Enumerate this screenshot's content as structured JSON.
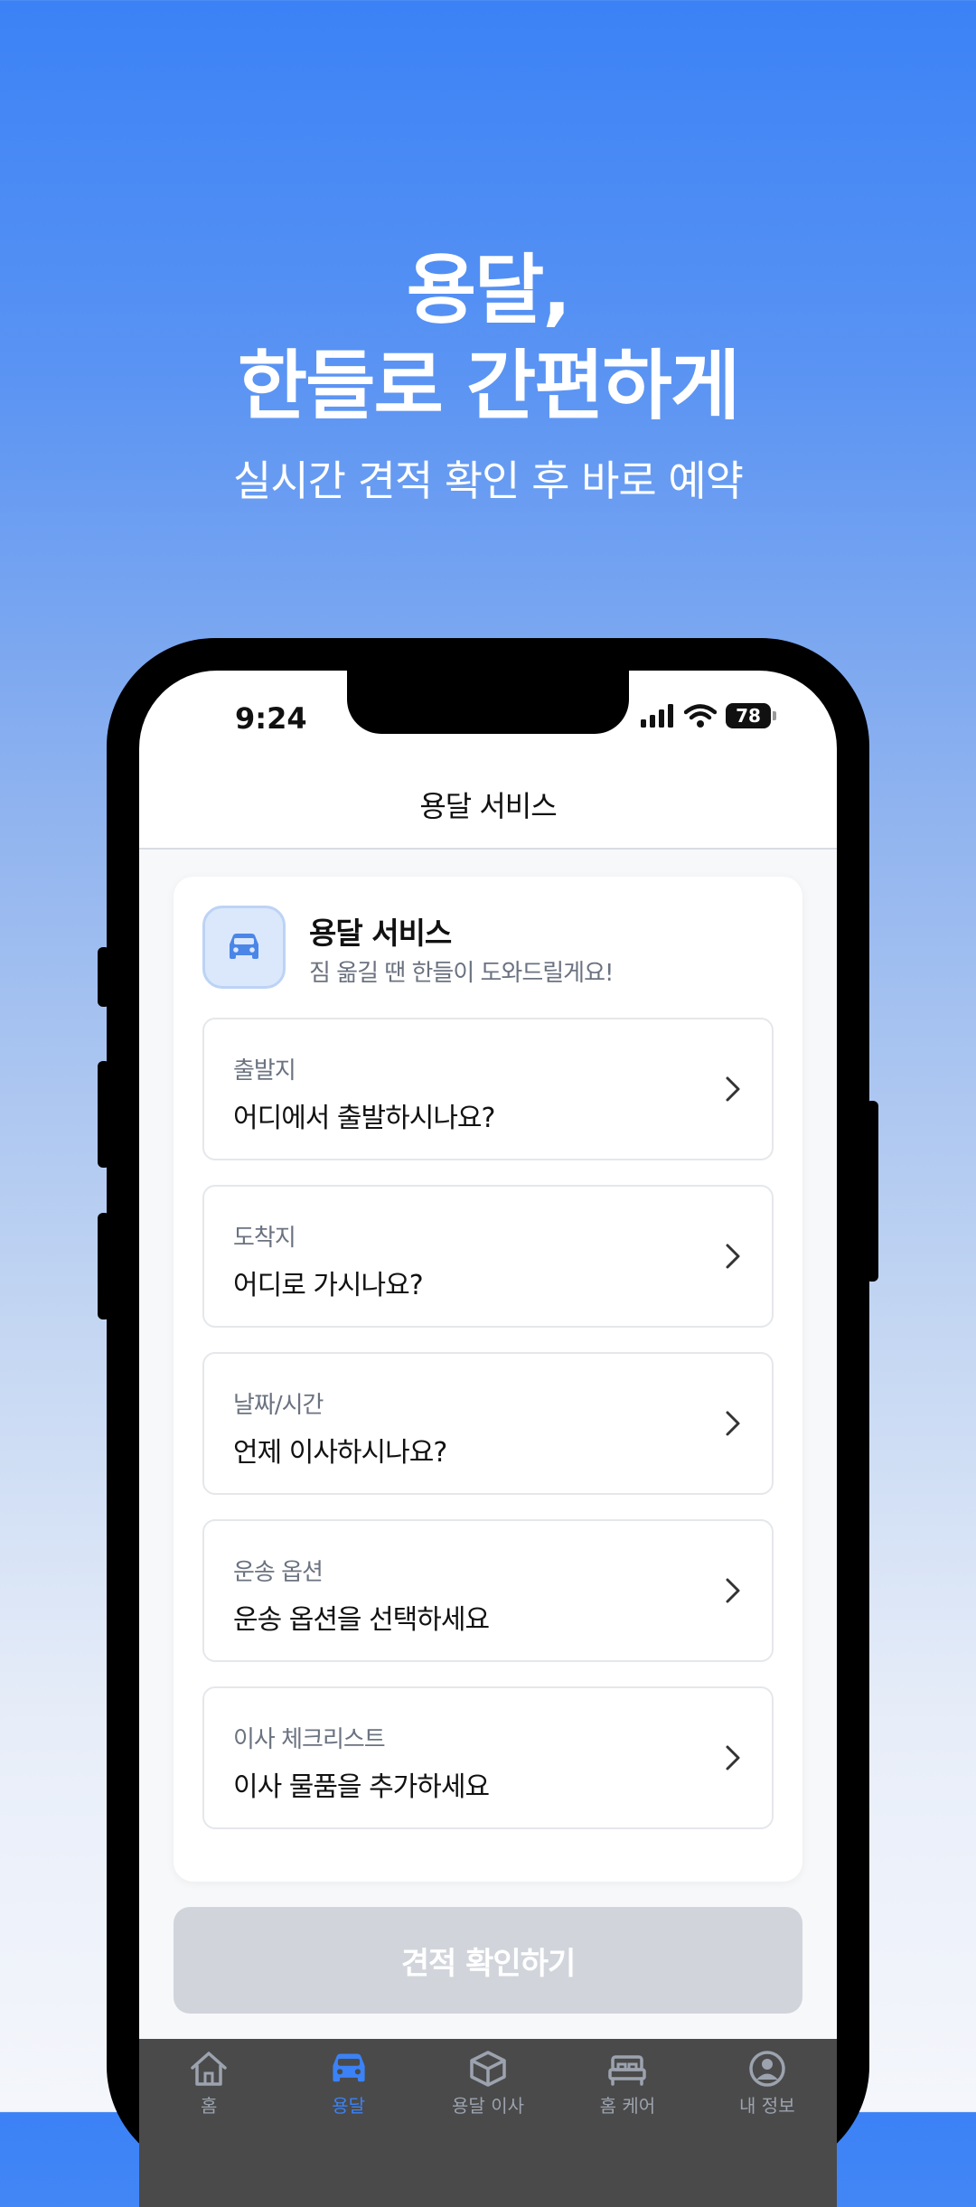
{
  "hero": {
    "title_line1": "용달,",
    "title_line2": "한들로 간편하게",
    "subtitle": "실시간 견적 확인 후 바로 예약"
  },
  "status_bar": {
    "time": "9:24",
    "battery": "78"
  },
  "nav": {
    "title": "용달 서비스"
  },
  "service": {
    "title": "용달 서비스",
    "description": "짐 옮길 땐 한들이 도와드릴게요!",
    "icon": "car-icon"
  },
  "fields": [
    {
      "label": "출발지",
      "value": "어디에서 출발하시나요?"
    },
    {
      "label": "도착지",
      "value": "어디로 가시나요?"
    },
    {
      "label": "날짜/시간",
      "value": "언제 이사하시나요?"
    },
    {
      "label": "운송 옵션",
      "value": "운송 옵션을 선택하세요"
    },
    {
      "label": "이사 체크리스트",
      "value": "이사 물품을 추가하세요"
    }
  ],
  "cta": {
    "label": "견적 확인하기"
  },
  "tabs": [
    {
      "label": "홈",
      "icon": "home-icon"
    },
    {
      "label": "용달",
      "icon": "car-icon",
      "active": true
    },
    {
      "label": "용달 이사",
      "icon": "box-icon"
    },
    {
      "label": "홈 케어",
      "icon": "bed-icon"
    },
    {
      "label": "내 정보",
      "icon": "user-icon"
    }
  ],
  "colors": {
    "accent": "#3b82f6",
    "cta_disabled": "#d1d5db",
    "tabbar_bg": "#4a4a4a"
  }
}
